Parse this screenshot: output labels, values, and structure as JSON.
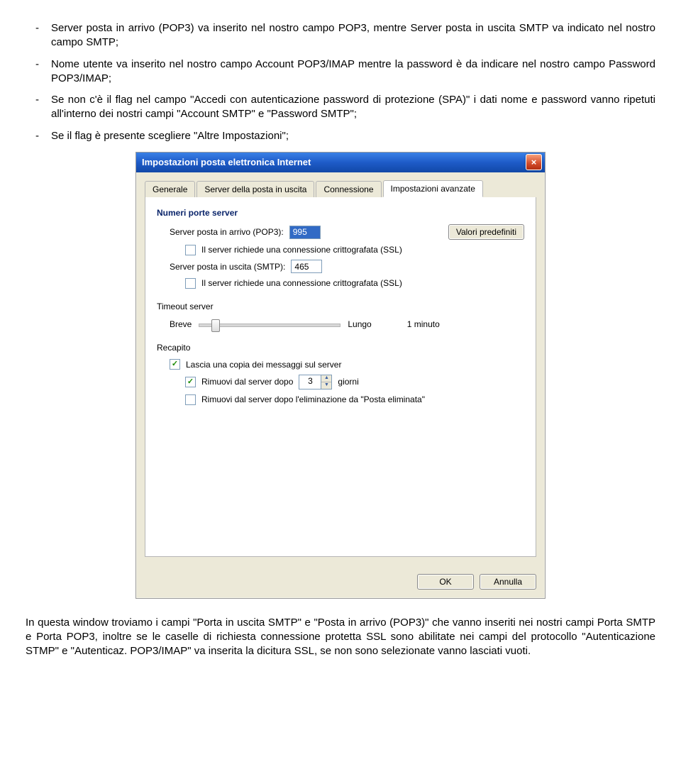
{
  "doc": {
    "bullets": [
      "Server posta in arrivo (POP3) va inserito nel nostro campo POP3, mentre Server posta in uscita SMTP va indicato nel nostro campo SMTP;",
      "Nome utente va inserito nel nostro campo Account POP3/IMAP mentre la password è da indicare nel nostro campo Password POP3/IMAP;",
      "Se non c'è il flag nel campo \"Accedi  con autenticazione password di protezione (SPA)\" i dati nome e password vanno ripetuti all'interno dei nostri campi \"Account SMTP\" e \"Password SMTP\";",
      "Se il flag è presente scegliere \"Altre Impostazioni\";"
    ],
    "para": "In questa window troviamo i campi \"Porta in uscita SMTP\" e \"Posta in arrivo (POP3)\"  che vanno inseriti nei nostri campi Porta SMTP e Porta POP3, inoltre se le caselle di richiesta connessione protetta SSL sono abilitate nei campi del protocollo \"Autenticazione STMP\" e \"Autenticaz. POP3/IMAP\" va inserita la dicitura SSL, se non sono selezionate vanno lasciati vuoti."
  },
  "dialog": {
    "title": "Impostazioni posta elettronica Internet",
    "tabs": [
      "Generale",
      "Server della posta in uscita",
      "Connessione",
      "Impostazioni avanzate"
    ],
    "active_tab": 3,
    "groups": {
      "ports": "Numeri porte server",
      "timeout": "Timeout server",
      "delivery": "Recapito"
    },
    "ports": {
      "pop3_label": "Server posta in arrivo (POP3):",
      "pop3_value": "995",
      "defaults_btn": "Valori predefiniti",
      "pop3_ssl": "Il server richiede una connessione crittografata (SSL)",
      "smtp_label": "Server posta in uscita (SMTP):",
      "smtp_value": "465",
      "smtp_ssl": "Il server richiede una connessione crittografata (SSL)"
    },
    "timeout": {
      "short": "Breve",
      "long": "Lungo",
      "value": "1 minuto"
    },
    "delivery": {
      "leave_copy": "Lascia una copia dei messaggi sul server",
      "remove_after_a": "Rimuovi dal server dopo",
      "remove_after_days_value": "3",
      "remove_after_b": "giorni",
      "remove_deleted": "Rimuovi dal server dopo l'eliminazione da \"Posta eliminata\""
    },
    "buttons": {
      "ok": "OK",
      "cancel": "Annulla"
    }
  }
}
